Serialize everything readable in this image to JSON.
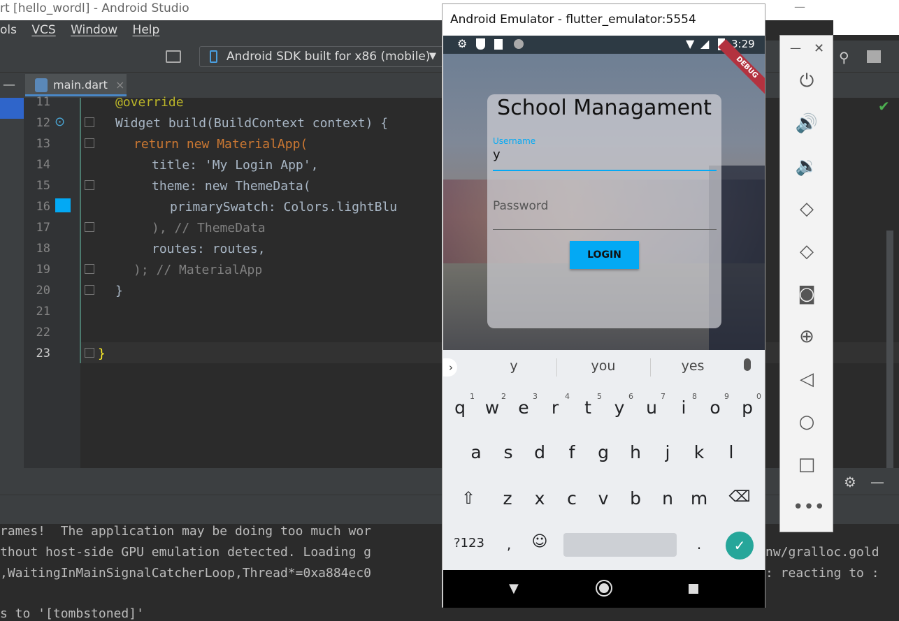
{
  "ide": {
    "title": "rt [hello_wordl] - Android Studio",
    "menu": [
      "ols",
      "VCS",
      "Window",
      "Help"
    ],
    "device_selector": "Android SDK built for x86 (mobile)",
    "tab": "main.dart",
    "code_lines": [
      {
        "n": "11",
        "text": "@override"
      },
      {
        "n": "12",
        "text": "Widget build(BuildContext context) {"
      },
      {
        "n": "13",
        "text": "return new MaterialApp("
      },
      {
        "n": "14",
        "text": "title: 'My Login App',"
      },
      {
        "n": "15",
        "text": "theme: new ThemeData("
      },
      {
        "n": "16",
        "text": "primarySwatch: Colors.lightBlu"
      },
      {
        "n": "17",
        "text": "), // ThemeData"
      },
      {
        "n": "18",
        "text": "routes: routes,"
      },
      {
        "n": "19",
        "text": "); // MaterialApp"
      },
      {
        "n": "20",
        "text": "}"
      },
      {
        "n": "21",
        "text": ""
      },
      {
        "n": "22",
        "text": ""
      },
      {
        "n": "23",
        "text": "}"
      }
    ],
    "log_lines": [
      "rames!  The application may be doing too much wor",
      "thout host-side GPU emulation detected. Loading g",
      ",WaitingInMainSignalCatcherLoop,Thread*=0xa884ec0",
      "s to '[tombstoned]'"
    ],
    "log_right": [
      "nw/gralloc.gold",
      ": reacting to :"
    ]
  },
  "emulator": {
    "title": "Android Emulator - flutter_emulator:5554",
    "time": "3:29",
    "debug_banner": "DEBUG",
    "app": {
      "heading": "School Managament",
      "username_label": "Username",
      "username_value": "y",
      "password_placeholder": "Password",
      "login_label": "LOGIN",
      "login_color": "#03a9f4"
    },
    "keyboard": {
      "suggestions": [
        "y",
        "you",
        "yes"
      ],
      "row1": [
        "q",
        "w",
        "e",
        "r",
        "t",
        "y",
        "u",
        "i",
        "o",
        "p"
      ],
      "row1_hints": [
        "1",
        "2",
        "3",
        "4",
        "5",
        "6",
        "7",
        "8",
        "9",
        "0"
      ],
      "row2": [
        "a",
        "s",
        "d",
        "f",
        "g",
        "h",
        "j",
        "k",
        "l"
      ],
      "row3": [
        "z",
        "x",
        "c",
        "v",
        "b",
        "n",
        "m"
      ],
      "symbols_key": "?123",
      "comma_key": ",",
      "period_key": "."
    }
  }
}
